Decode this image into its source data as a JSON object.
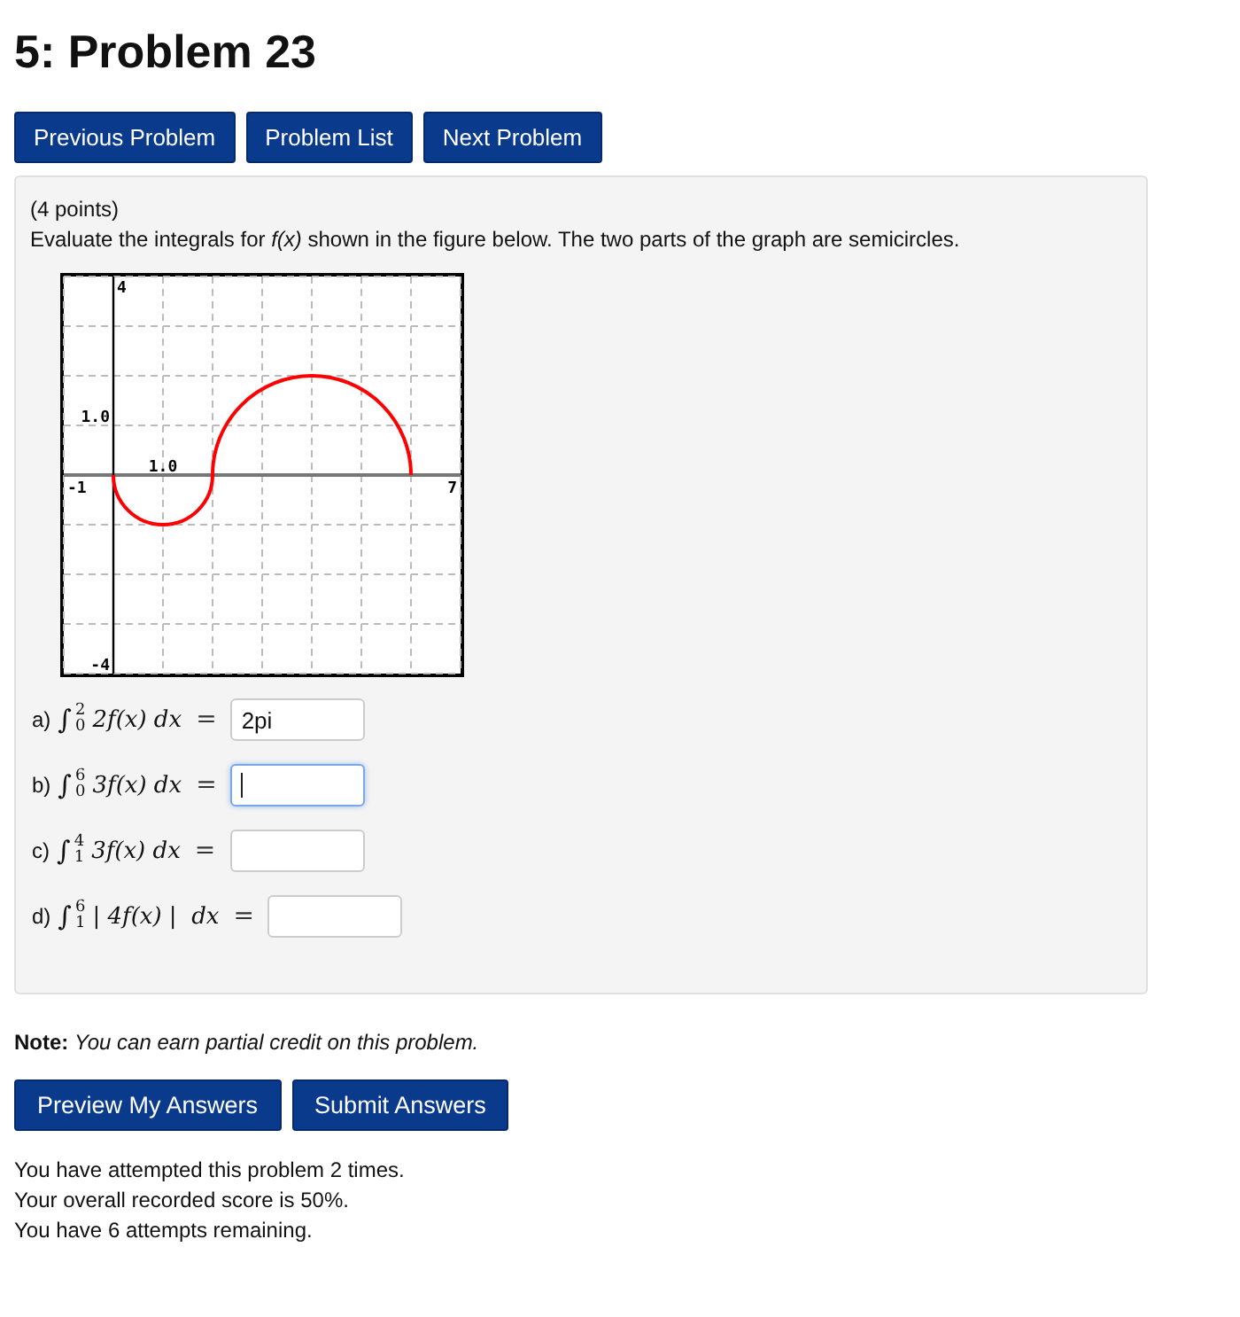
{
  "title": "5: Problem 23",
  "nav_buttons": [
    "Previous Problem",
    "Problem List",
    "Next Problem"
  ],
  "problem": {
    "points": "(4 points)",
    "statement": "Evaluate the integrals for *f(x)* shown in the figure below. The two parts of the graph are semicircles.",
    "graph": {
      "y_labels": [
        "4",
        "1.0",
        "-4"
      ],
      "x_labels": [
        "-1",
        "1.0",
        "7"
      ]
    },
    "parts": [
      {
        "label": "a)",
        "sign": "∫",
        "lower": "0",
        "upper": "2",
        "integrand": "2f(x) dx",
        "equals": "=",
        "value": "2pi",
        "focused": false
      },
      {
        "label": "b)",
        "sign": "∫",
        "lower": "0",
        "upper": "6",
        "integrand": "3f(x) dx",
        "equals": "=",
        "focused": true
      },
      {
        "label": "c)",
        "sign": "∫",
        "lower": "1",
        "upper": "4",
        "integrand": "3f(x) dx",
        "equals": "=",
        "focused": false
      },
      {
        "label": "d)",
        "sign": "∫",
        "lower": "1",
        "upper": "6",
        "integrand": "| 4f(x) |  dx",
        "equals": "=",
        "focused": false
      }
    ]
  },
  "note": {
    "label": "Note:",
    "text": "You can earn partial credit on this problem."
  },
  "submit_buttons": [
    "Preview My Answers",
    "Submit Answers"
  ],
  "status_lines": [
    "You have attempted this problem 2 times.",
    "Your overall recorded score is 50%.",
    "You have 6 attempts remaining."
  ]
}
